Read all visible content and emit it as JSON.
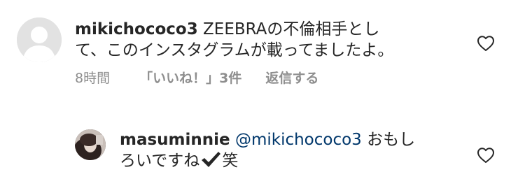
{
  "comment1": {
    "username": "mikichococo3",
    "text_line1": " ZEEBRAの不倫相手とし",
    "text_line2": "て、このインスタグラムが載ってましたよ。",
    "time": "8時間",
    "likes": "「いいね！」3件",
    "reply": "返信する"
  },
  "comment2": {
    "username": "masuminnie",
    "mention": "@mikichococo3",
    "text_line1": " おもし",
    "text_line2_a": "ろいですね",
    "text_line2_b": "笑"
  },
  "icons": {
    "avatar_default": "default-avatar-icon",
    "heart": "heart-outline-icon",
    "check": "heavy-check-mark-icon"
  },
  "colors": {
    "text": "#262626",
    "secondary": "#8e8e8e",
    "mention": "#00376b",
    "avatar_placeholder": "#e2e2e2"
  }
}
